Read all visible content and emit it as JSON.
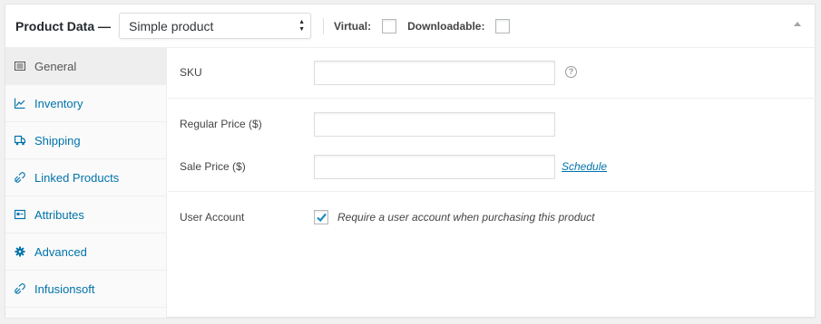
{
  "header": {
    "title": "Product Data —",
    "product_type": "Simple product",
    "virtual_label": "Virtual:",
    "downloadable_label": "Downloadable:"
  },
  "sidebar": {
    "tabs": [
      {
        "label": "General",
        "icon": "general-icon",
        "active": true
      },
      {
        "label": "Inventory",
        "icon": "inventory-icon",
        "active": false
      },
      {
        "label": "Shipping",
        "icon": "shipping-icon",
        "active": false
      },
      {
        "label": "Linked Products",
        "icon": "linked-products-icon",
        "active": false
      },
      {
        "label": "Attributes",
        "icon": "attributes-icon",
        "active": false
      },
      {
        "label": "Advanced",
        "icon": "gear-icon",
        "active": false
      },
      {
        "label": "Infusionsoft",
        "icon": "infusionsoft-icon",
        "active": false
      }
    ]
  },
  "general": {
    "sku_label": "SKU",
    "sku_value": "",
    "help_glyph": "?",
    "regular_price_label": "Regular Price ($)",
    "regular_price_value": "",
    "sale_price_label": "Sale Price ($)",
    "sale_price_value": "",
    "schedule_link": "Schedule",
    "user_account_label": "User Account",
    "user_account_checked": true,
    "user_account_desc": "Require a user account when purchasing this product"
  },
  "colors": {
    "link": "#0073aa",
    "active_tab_bg": "#eeeeee",
    "border": "#dddddd"
  }
}
